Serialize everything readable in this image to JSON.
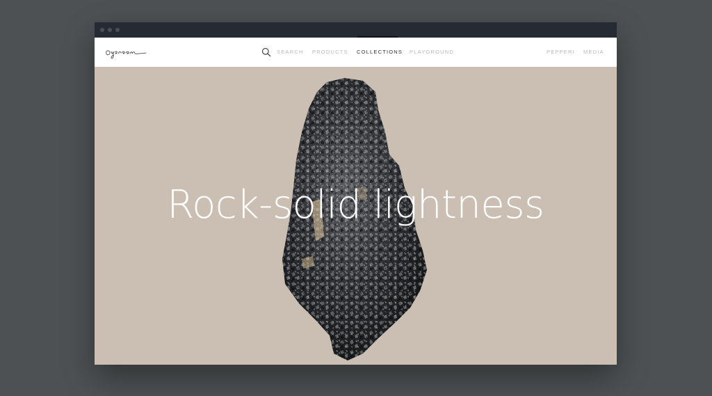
{
  "browser": {
    "window_dots": [
      "close",
      "minimize",
      "maximize"
    ]
  },
  "header": {
    "logo_icon": "handwritten-logo-icon",
    "search_icon": "search-icon",
    "nav": [
      {
        "label": "SEARCH",
        "active": false
      },
      {
        "label": "PRODUCTS",
        "active": false
      },
      {
        "label": "COLLECTIONS",
        "active": true
      },
      {
        "label": "PLAYGROUND",
        "active": false
      }
    ],
    "nav_right": [
      {
        "label": "PEPPERI",
        "active": false
      },
      {
        "label": "MEDIA",
        "active": false
      }
    ]
  },
  "hero": {
    "headline": "Rock-solid lightness",
    "image": "mineral-rock-image",
    "background_color": "#cbbfb3"
  },
  "colors": {
    "page_background": "#4d5153",
    "titlebar": "#262b33",
    "nav_active": "#333333",
    "nav_inactive": "#b9b9b9"
  }
}
